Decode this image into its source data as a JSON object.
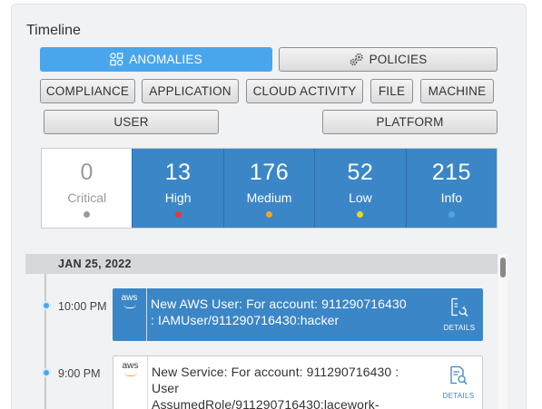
{
  "panel": {
    "title": "Timeline"
  },
  "filters": {
    "anomalies": "ANOMALIES",
    "policies": "POLICIES",
    "compliance": "COMPLIANCE",
    "application": "APPLICATION",
    "cloud_activity": "CLOUD ACTIVITY",
    "file": "FILE",
    "machine": "MACHINE",
    "user": "USER",
    "platform": "PLATFORM",
    "active": "anomalies"
  },
  "severity": [
    {
      "count": "0",
      "label": "Critical",
      "dot_color": "#9a9a9a"
    },
    {
      "count": "13",
      "label": "High",
      "dot_color": "#e53935"
    },
    {
      "count": "176",
      "label": "Medium",
      "dot_color": "#f0a52c"
    },
    {
      "count": "52",
      "label": "Low",
      "dot_color": "#f3d22d"
    },
    {
      "count": "215",
      "label": "Info",
      "dot_color": "#4aa6ec"
    }
  ],
  "timeline": {
    "date": "JAN 25, 2022",
    "events": [
      {
        "time": "10:00 PM",
        "provider_icon": "aws-icon",
        "provider_label": "aws",
        "line1": "New AWS User: For account: 911290716430",
        "line2": ": IAMUser/911290716430:hacker",
        "line3": "",
        "details_label": "DETAILS",
        "selected": true
      },
      {
        "time": "9:00 PM",
        "provider_icon": "aws-icon",
        "provider_label": "aws",
        "line1": "New Service: For account: 911290716430 :",
        "line2": "User",
        "line3": "AssumedRole/911290716430:lacework-",
        "details_label": "DETAILS",
        "selected": false
      }
    ]
  },
  "colors": {
    "accent": "#4aa6ec",
    "severity_fill": "#3b86c6"
  }
}
